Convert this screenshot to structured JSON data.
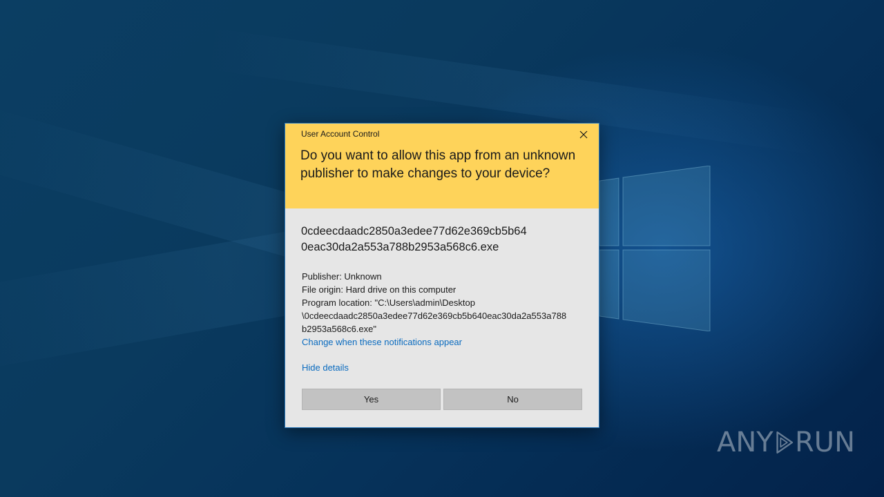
{
  "dialog": {
    "title": "User Account Control",
    "question": "Do you want to allow this app from an unknown publisher to make changes to your device?",
    "program_name_line1": "0cdeecdaadc2850a3edee77d62e369cb5b64",
    "program_name_line2": "0eac30da2a553a788b2953a568c6.exe",
    "publisher": "Publisher: Unknown",
    "file_origin": "File origin: Hard drive on this computer",
    "program_location_line1": "Program location: \"C:\\Users\\admin\\Desktop",
    "program_location_line2": "\\0cdeecdaadc2850a3edee77d62e369cb5b640eac30da2a553a788",
    "program_location_line3": "b2953a568c6.exe\"",
    "change_notifications_link": "Change when these notifications appear",
    "hide_details_link": "Hide details",
    "yes_label": "Yes",
    "no_label": "No"
  },
  "watermark": {
    "text_left": "ANY",
    "text_right": "RUN"
  },
  "colors": {
    "header_bg": "#fed35a",
    "body_bg": "#e6e6e6",
    "link": "#0a6bbf",
    "button_bg": "#c2c2c2",
    "border": "#2b7bbf"
  },
  "icons": {
    "close": "close-icon",
    "desktop_logo": "windows-logo-icon",
    "watermark_logo": "play-icon"
  }
}
